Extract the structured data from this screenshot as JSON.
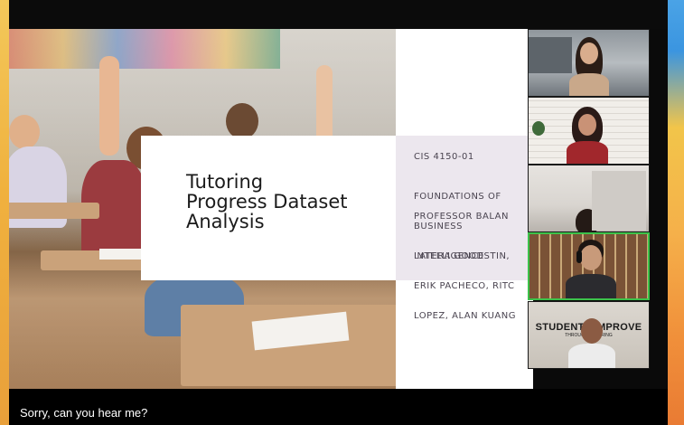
{
  "window": {
    "title": ""
  },
  "slide": {
    "title_lines": [
      "Tutoring",
      "Progress Dataset",
      "Analysis"
    ],
    "course_code": "CIS 4150-01",
    "course_name_lines": [
      "FOUNDATIONS OF",
      "BUSINESS",
      "INTELLIGENCE"
    ],
    "professor": "PROFESSOR BALAN",
    "authors_lines": [
      "LATERA GOODSTIN,",
      "ERIK PACHECO, RITC",
      "LOPEZ, ALAN KUANG"
    ]
  },
  "participants": [
    {
      "background": "city-office",
      "active": false
    },
    {
      "background": "brick-wall",
      "active": false
    },
    {
      "background": "plain-room",
      "active": false
    },
    {
      "background": "shelves",
      "active": true
    },
    {
      "background": "students-improve-banner",
      "active": false,
      "banner_text": "STUDENTS IMPROVE",
      "banner_sub": "THROUGH TUTORING"
    }
  ],
  "captions": {
    "text": "Sorry, can you hear me?"
  },
  "colors": {
    "active_speaker": "#3cc24a",
    "slide_panel": "#ece7ee"
  }
}
